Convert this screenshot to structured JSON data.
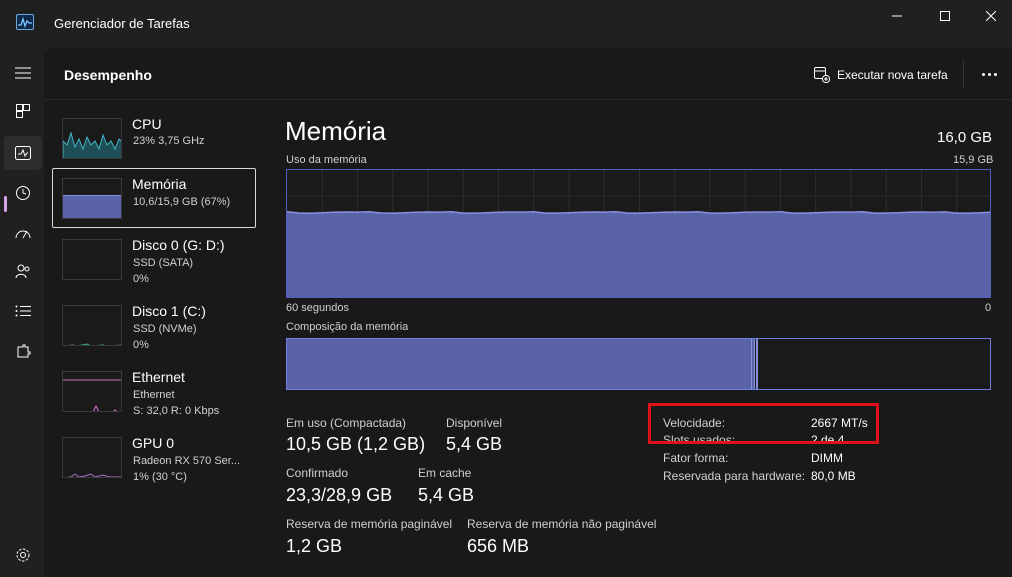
{
  "window": {
    "title": "Gerenciador de Tarefas",
    "controls": [
      "minimize",
      "maximize",
      "close"
    ]
  },
  "rail": {
    "items": [
      {
        "name": "hamburger-icon",
        "active": false
      },
      {
        "name": "processes-icon",
        "active": false
      },
      {
        "name": "performance-icon",
        "active": true
      },
      {
        "name": "app-history-icon",
        "active": false
      },
      {
        "name": "startup-apps-icon",
        "active": false
      },
      {
        "name": "users-icon",
        "active": false
      },
      {
        "name": "details-icon",
        "active": false
      },
      {
        "name": "services-icon",
        "active": false
      }
    ],
    "settings": "settings-icon"
  },
  "header": {
    "title": "Desempenho",
    "run_task_label": "Executar nova tarefa"
  },
  "devices": [
    {
      "name": "CPU",
      "sub1": "23% 3,75 GHz",
      "sub2": "",
      "sub3": ""
    },
    {
      "name": "Memória",
      "sub1": "10,6/15,9 GB (67%)",
      "sub2": "",
      "sub3": ""
    },
    {
      "name": "Disco 0 (G: D:)",
      "sub1": "SSD (SATA)",
      "sub2": "0%",
      "sub3": ""
    },
    {
      "name": "Disco 1 (C:)",
      "sub1": "SSD (NVMe)",
      "sub2": "0%",
      "sub3": ""
    },
    {
      "name": "Ethernet",
      "sub1": "Ethernet",
      "sub2": "S: 32,0 R: 0 Kbps",
      "sub3": ""
    },
    {
      "name": "GPU 0",
      "sub1": "Radeon RX 570 Ser...",
      "sub2": "1% (30 °C)",
      "sub3": ""
    }
  ],
  "memory": {
    "title": "Memória",
    "total": "16,0 GB",
    "usage_label": "Uso da memória",
    "usage_max": "15,9 GB",
    "time_left": "60 segundos",
    "time_right": "0",
    "composition_label": "Composição da memória",
    "usage_fraction": 0.67,
    "in_use_fraction": 0.66,
    "modified_fraction": 0.005,
    "stats": {
      "in_use_label": "Em uso (Compactada)",
      "in_use_value": "10,5 GB (1,2 GB)",
      "available_label": "Disponível",
      "available_value": "5,4 GB",
      "committed_label": "Confirmado",
      "committed_value": "23,3/28,9 GB",
      "cached_label": "Em cache",
      "cached_value": "5,4 GB",
      "paged_label": "Reserva de memória paginável",
      "paged_value": "1,2 GB",
      "nonpaged_label": "Reserva de memória não paginável",
      "nonpaged_value": "656 MB"
    },
    "specs": {
      "speed_label": "Velocidade:",
      "speed_value": "2667 MT/s",
      "slots_label": "Slots usados:",
      "slots_value": "2 de 4",
      "form_label": "Fator forma:",
      "form_value": "DIMM",
      "reserved_label": "Reservada para hardware:",
      "reserved_value": "80,0 MB"
    }
  },
  "colors": {
    "memory_fill": "#5a62a8",
    "memory_border": "#7080e0",
    "cpu_line": "#3fb6c8",
    "ethernet_line": "#d670c8",
    "highlight": "#e0111b"
  }
}
